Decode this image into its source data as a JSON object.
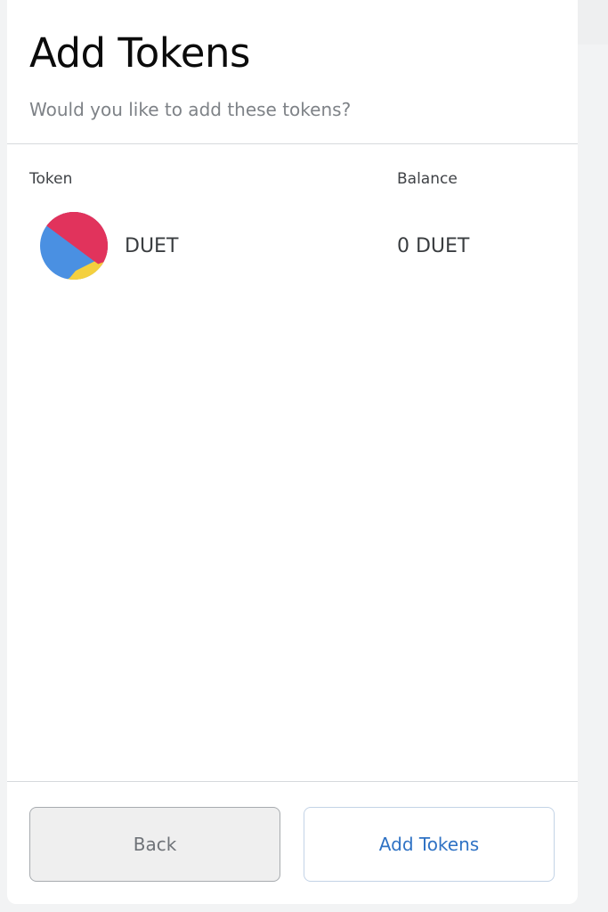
{
  "dialog": {
    "title": "Add Tokens",
    "subtitle": "Would you like to add these tokens?"
  },
  "table": {
    "headers": {
      "token": "Token",
      "balance": "Balance"
    },
    "rows": [
      {
        "symbol": "DUET",
        "balance": "0 DUET",
        "icon": "token-identicon-icon",
        "icon_colors": [
          "#e1335c",
          "#4a90e2",
          "#f4d03f"
        ]
      }
    ]
  },
  "footer": {
    "back_label": "Back",
    "add_label": "Add Tokens"
  },
  "colors": {
    "accent": "#2f72c4",
    "background": "#ffffff"
  }
}
